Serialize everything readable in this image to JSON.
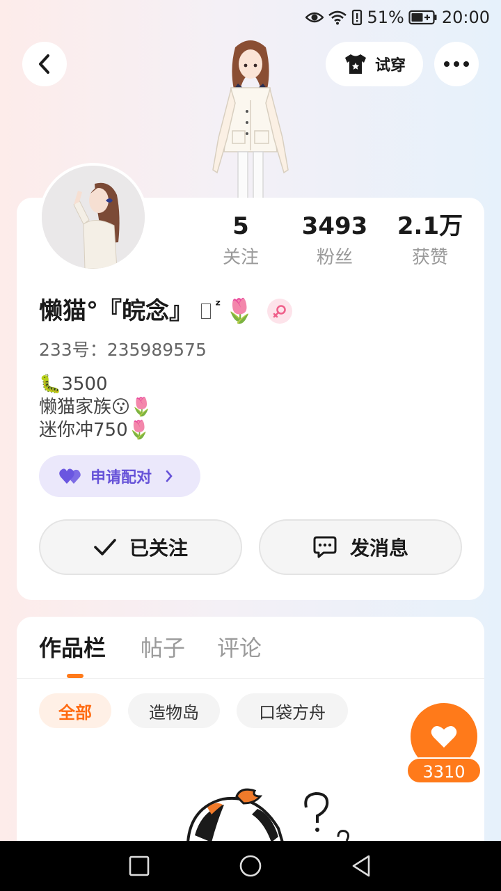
{
  "status_bar": {
    "battery": "51%",
    "time": "20:00",
    "icons": [
      "eye-icon",
      "wifi-icon",
      "battery-alert-icon",
      "battery-charging-icon"
    ]
  },
  "header": {
    "back_icon": "chevron-left-icon",
    "try_on_label": "试穿",
    "try_on_icon": "tshirt-icon",
    "more_icon": "more-dots-icon"
  },
  "profile": {
    "stats": [
      {
        "value": "5",
        "label": "关注"
      },
      {
        "value": "3493",
        "label": "粉丝"
      },
      {
        "value": "2.1万",
        "label": "获赞"
      }
    ],
    "nickname": "懒猫°『皖念』",
    "nickname_suffix": "ᶻ",
    "nickname_emoji": "🌷",
    "gender_icon": "female-icon",
    "uid_text": "233号：235989575",
    "bio_lines": [
      "🐛3500",
      "懒猫家族😗🌷",
      "迷你冲750🌷"
    ],
    "pair_button_label": "申请配对",
    "follow_button_label": "已关注",
    "message_button_label": "发消息"
  },
  "works": {
    "tabs": [
      "作品栏",
      "帖子",
      "评论"
    ],
    "active_tab": "作品栏",
    "filters": [
      "全部",
      "造物岛",
      "口袋方舟"
    ],
    "active_filter": "全部",
    "like_count": "3310"
  },
  "colors": {
    "accent_orange": "#ff7a1a",
    "pair_purple": "#6652d8",
    "pair_bg": "#ebe8fb"
  }
}
